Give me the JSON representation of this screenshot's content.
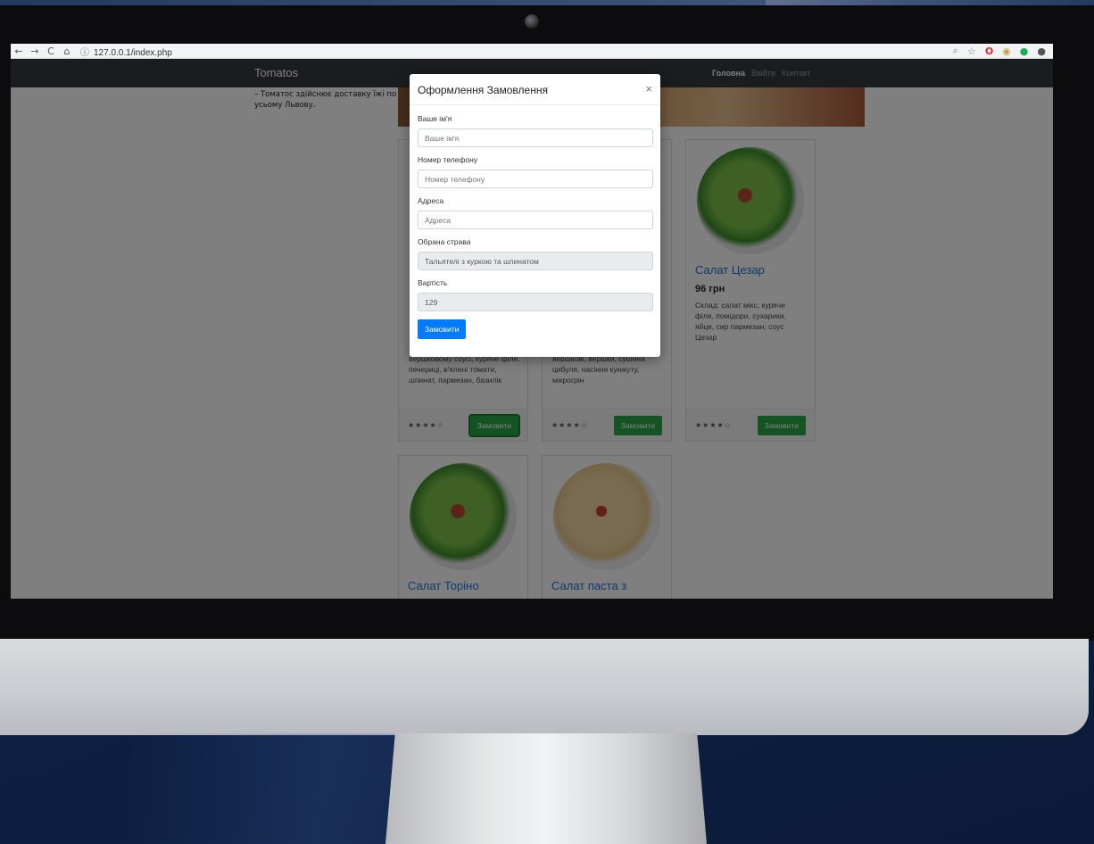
{
  "browser": {
    "url": "127.0.0.1/index.php"
  },
  "site": {
    "brand": "Tomatos",
    "menu": [
      "Головна",
      "Ввійти",
      "Контакт"
    ],
    "side_text": "– Томатос здійснює доставку їжі по усьому Львову."
  },
  "cards": [
    {
      "title": "Салат Цезар",
      "price": "96 грн",
      "desc": "Склад: салат мікс, куряче філе, помідори, сухарики, яйце, сир пармезан, соус Цезар",
      "stars": "★★★★☆",
      "button": "Замовити"
    },
    {
      "partial_desc": "вершковому соусі, куряче філе, печериці, в'ялені томати, шпинат, пармезан, базилік",
      "stars": "★★★★☆",
      "button": "Замовити"
    },
    {
      "partial_desc": "вершкові, вершки, сушена цибуля, насіння кунжуту, мікрогрін",
      "stars": "★★★★☆",
      "button": "Замовити"
    }
  ],
  "bottom_cards": [
    {
      "title": "Салат Торіно"
    },
    {
      "title": "Салат паста з"
    }
  ],
  "modal": {
    "title": "Оформлення Замовлення",
    "close": "×",
    "fields": [
      {
        "label": "Ваше ім'я",
        "placeholder": "Ваше ім'я"
      },
      {
        "label": "Номер телефону",
        "placeholder": "Номер телефону"
      },
      {
        "label": "Адреса",
        "placeholder": "Адреса"
      },
      {
        "label": "Обрана страва",
        "value": "Тальятелі з куркою та шпинатом"
      },
      {
        "label": "Вартість",
        "value": "129"
      }
    ],
    "submit": "Замовити"
  }
}
